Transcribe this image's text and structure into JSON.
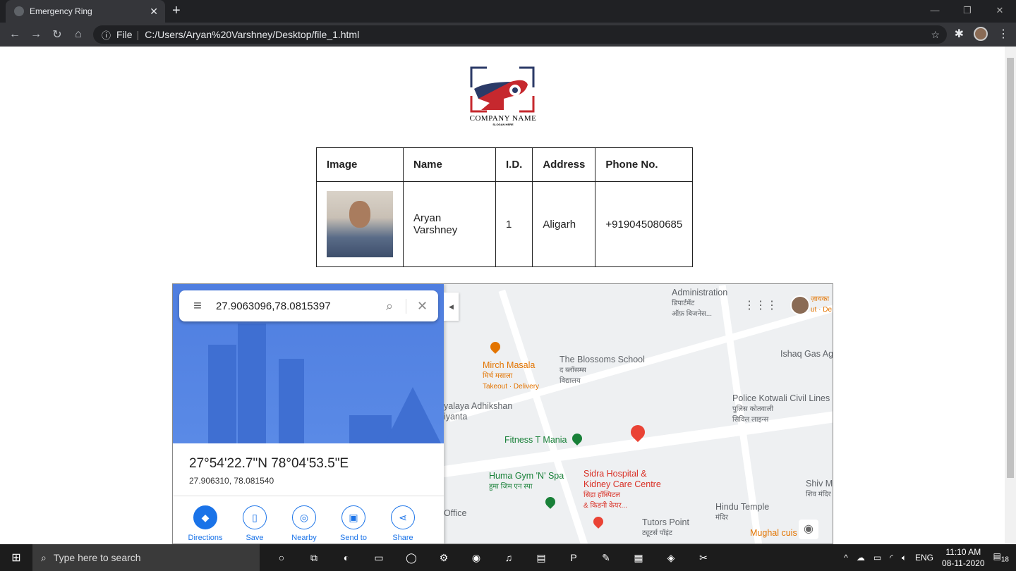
{
  "browser": {
    "tab_title": "Emergency Ring",
    "new_tab": "+",
    "url_scheme": "File",
    "url": "C:/Users/Aryan%20Varshney/Desktop/file_1.html"
  },
  "logo": {
    "company": "COMPANY NAME",
    "slogan": "SLOGAN HERE",
    "colors": {
      "navy": "#2b3a67",
      "red": "#c6282e"
    }
  },
  "table": {
    "headers": [
      "Image",
      "Name",
      "I.D.",
      "Address",
      "Phone No."
    ],
    "rows": [
      {
        "name": "Aryan Varshney",
        "id": "1",
        "address": "Aligarh",
        "phone": "+919045080685"
      }
    ]
  },
  "map": {
    "search": "27.9063096,78.0815397",
    "coords_dms": "27°54'22.7\"N 78°04'53.5\"E",
    "coords_dec": "27.906310, 78.081540",
    "actions": [
      {
        "label": "Directions",
        "icon": "directions-icon"
      },
      {
        "label": "Save",
        "icon": "bookmark-icon"
      },
      {
        "label": "Nearby",
        "icon": "nearby-icon"
      },
      {
        "label": "Send to your",
        "icon": "send-to-phone-icon"
      },
      {
        "label": "Share",
        "icon": "share-icon"
      }
    ],
    "places": {
      "dept": "Administration",
      "dept_hi": "डिपार्टमेंट",
      "dept_hi2": "ऑफ़ बिजनेस...",
      "mirch": "Mirch Masala",
      "mirch_hi": "मिर्च मसाला",
      "mirch_sub": "Takeout · Delivery",
      "blossoms": "The Blossoms School",
      "blossoms_hi": "द ब्लॉसम्स",
      "blossoms_hi2": "विद्यालय",
      "adhik": "yalaya Adhikshan",
      "adhik2": "iyanta",
      "fitness": "Fitness T Mania",
      "huma": "Huma Gym 'N' Spa",
      "huma_hi": "हुमा जिम एन स्पा",
      "sidra": "Sidra Hospital &",
      "sidra2": "Kidney Care Centre",
      "sidra_hi": "सिद्रा हॉस्पिटल",
      "sidra_hi2": "& किडनी केयर...",
      "ishaq": "Ishaq Gas Ag",
      "police": "Police Kotwali Civil Lines",
      "police_hi": "पुलिस कोतवाली",
      "police_hi2": "सिविल लाइन्स",
      "shiv": "Shiv M",
      "shiv_hi": "शिव मंदिर",
      "hindu": "Hindu Temple",
      "hindu_hi": "मंदिर",
      "tutors": "Tutors Point",
      "tutors_hi": "ट्यूटर्स पॉइंट",
      "mughal": "Mughal cuis",
      "office": "Office",
      "zaika": "ज़ायका",
      "zaika_sub": "ut · De"
    }
  },
  "taskbar": {
    "search_placeholder": "Type here to search",
    "lang": "ENG",
    "time": "11:10 AM",
    "date": "08-11-2020",
    "notifications": "18"
  }
}
